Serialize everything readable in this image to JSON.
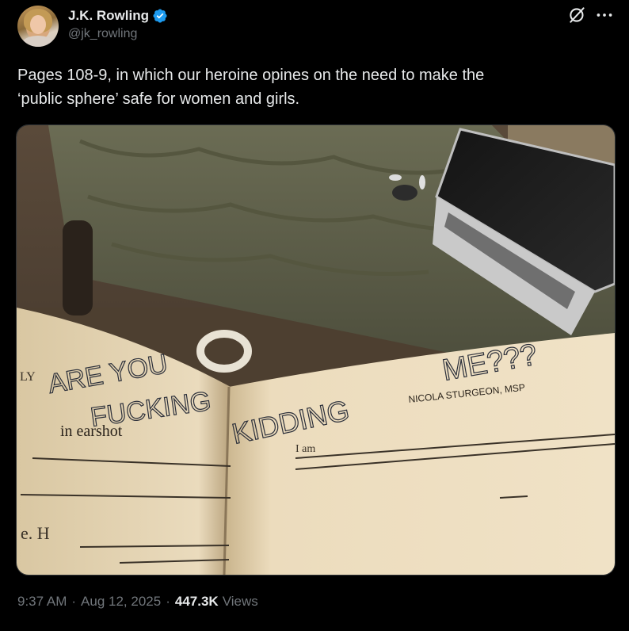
{
  "author": {
    "name": "J.K. Rowling",
    "handle": "@jk_rowling",
    "verified": true
  },
  "tweet": {
    "text": "Pages 108-9, in which our heroine opines on the need to make the\n‘public sphere’ safe for women and girls.",
    "time": "9:37 AM",
    "date": "Aug 12, 2025",
    "views_count": "447.3K",
    "views_label": "Views",
    "separator": "·"
  },
  "media": {
    "handwriting_left_1": "ARE YOU",
    "handwriting_left_2": "FUCKING",
    "handwriting_right_1": "KIDDING",
    "handwriting_right_2": "ME???",
    "printed_header": "NICOLA STURGEON, MSP",
    "printed_left_fragment_1": "LY",
    "printed_left_fragment_2": "in earshot",
    "printed_left_fragment_3": "e. H",
    "printed_right_fragment_1": "I am"
  },
  "colors": {
    "background": "#000000",
    "text_primary": "#e7e9ea",
    "text_secondary": "#71767b",
    "verified_blue": "#1d9bf0",
    "border": "#2f3336"
  },
  "icons": {
    "verified": "verified-badge-icon",
    "grok": "grok-icon",
    "more": "more-horizontal-icon"
  }
}
